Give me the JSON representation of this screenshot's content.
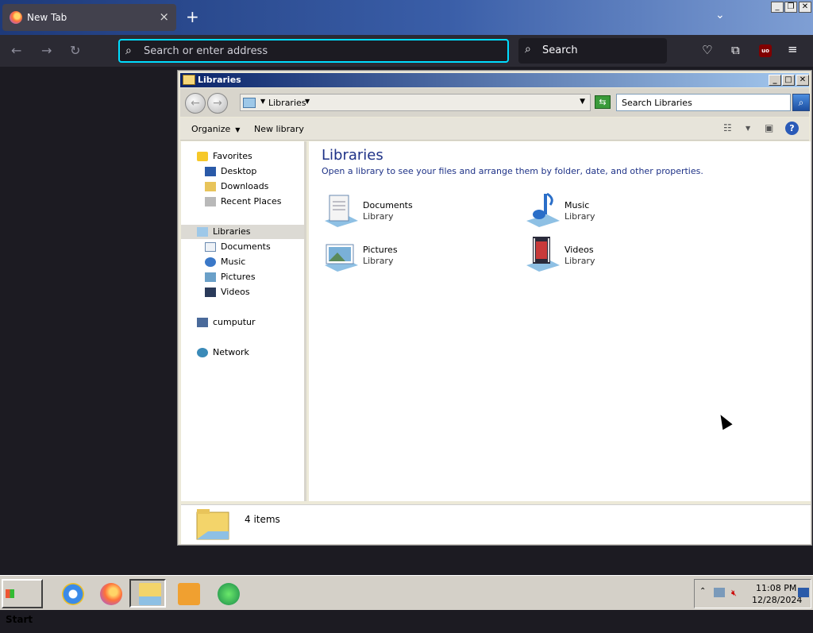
{
  "browser": {
    "tab_title": "New Tab",
    "tab_close": "×",
    "new_tab": "+",
    "list_all_tabs": "⌄",
    "url_placeholder": "Search or enter address",
    "search_label": "Search",
    "window_controls": [
      "_",
      "❐",
      "✕"
    ],
    "toolbar_icons": [
      "pocket-icon",
      "extensions-icon",
      "ublock-icon",
      "menu-icon"
    ],
    "ublock_label": "uo"
  },
  "explorer": {
    "title": "Libraries",
    "window_controls": [
      "_",
      "□",
      "✕"
    ],
    "breadcrumb": "Libraries",
    "search_placeholder": "Search Libraries",
    "commands": {
      "organize": "Organize",
      "new_library": "New library"
    },
    "nav": {
      "favorites": "Favorites",
      "favorites_items": [
        "Desktop",
        "Downloads",
        "Recent Places"
      ],
      "libraries": "Libraries",
      "libraries_items": [
        "Documents",
        "Music",
        "Pictures",
        "Videos"
      ],
      "computer": "cumputur",
      "network": "Network"
    },
    "heading": "Libraries",
    "description": "Open a library to see your files and arrange them by folder, date, and other properties.",
    "libraries": [
      {
        "name": "Documents",
        "sub": "Library",
        "icon": "documents-library-icon"
      },
      {
        "name": "Music",
        "sub": "Library",
        "icon": "music-library-icon"
      },
      {
        "name": "Pictures",
        "sub": "Library",
        "icon": "pictures-library-icon"
      },
      {
        "name": "Videos",
        "sub": "Library",
        "icon": "videos-library-icon"
      }
    ],
    "item_count": "4 items"
  },
  "taskbar": {
    "start_label": "Start",
    "apps": [
      "internet-explorer-icon",
      "firefox-icon",
      "explorer-icon",
      "media-player-icon",
      "messenger-icon"
    ],
    "time": "11:08 PM",
    "date": "12/28/2024"
  },
  "colors": {
    "accent": "#00ddff",
    "title_bar": "#0a246a",
    "link_text": "#1e3287"
  }
}
